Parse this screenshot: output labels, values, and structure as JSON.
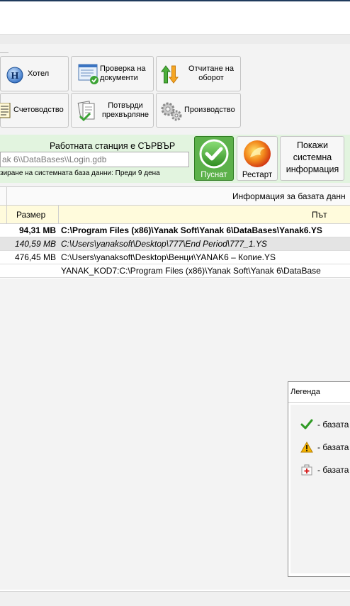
{
  "toolbar": {
    "hotel": "Хотел",
    "check_docs": "Проверка на документи",
    "turnover": "Отчитане на оборот",
    "accounting": "Счетоводство",
    "confirm_transfer": "Потвърди прехвърляне",
    "production": "Производство"
  },
  "server": {
    "workstation_label": "Работната станция е СЪРВЪР",
    "db_path": "ak 6\\\\DataBases\\\\Login.gdb",
    "sync_info": "зиране на системната база данни: Преди 9 дена",
    "running_label": "Пуснат",
    "restart_label": "Рестарт",
    "sysinfo_label": "Покажи системна информация"
  },
  "grid": {
    "group_header": "Информация за базата данн",
    "columns": {
      "size": "Размер",
      "path": "Път"
    },
    "rows": [
      {
        "size": "94,31 MB",
        "path": "C:\\Program Files (x86)\\Yanak Soft\\Yanak 6\\DataBases\\Yanak6.YS",
        "style": "bold"
      },
      {
        "size": "140,59 MB",
        "path": "C:\\Users\\yanaksoft\\Desktop\\777\\End Period\\777_1.YS",
        "style": "italic"
      },
      {
        "size": "476,45 MB",
        "path": "C:\\Users\\yanaksoft\\Desktop\\Венци\\YANAK6 – Копие.YS",
        "style": "normal"
      },
      {
        "size": "",
        "path": "YANAK_KOD7:C:\\Program Files (x86)\\Yanak Soft\\Yanak 6\\DataBase",
        "style": "normal"
      }
    ]
  },
  "legend": {
    "title": "Легенда",
    "items": [
      {
        "icon": "check-icon",
        "text": "- базата"
      },
      {
        "icon": "warning-icon",
        "text": "- базата"
      },
      {
        "icon": "first-aid-icon",
        "text": "- базата"
      }
    ]
  },
  "colors": {
    "accent_green": "#49b53a",
    "header_yellow": "#fffbdc",
    "panel_green": "#e2f4df"
  }
}
